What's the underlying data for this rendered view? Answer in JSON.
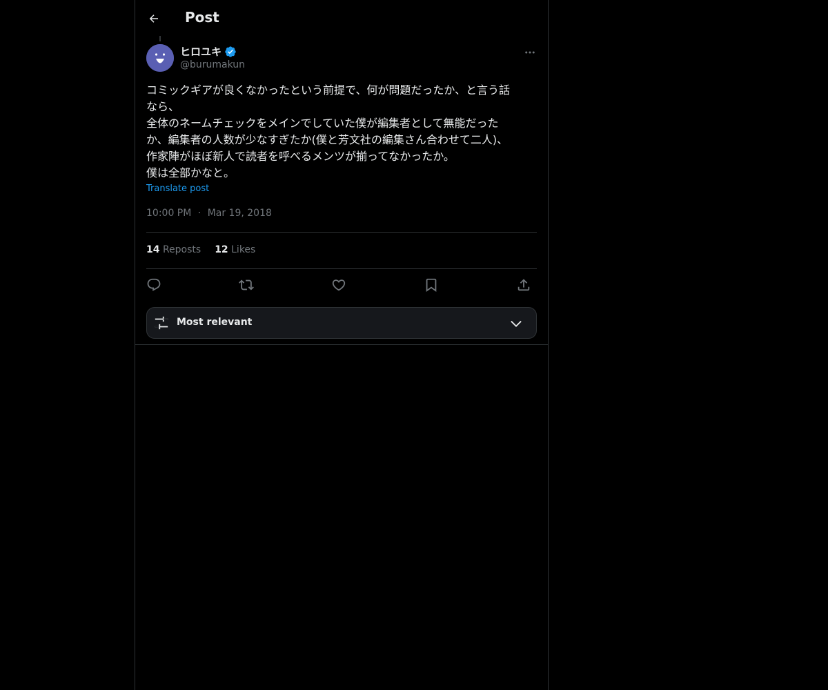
{
  "header": {
    "title": "Post",
    "back_icon": "arrow-left-icon"
  },
  "author": {
    "name": "ヒロユキ",
    "handle": "@burumakun",
    "verified": true,
    "avatar_color": "#5a5fb3"
  },
  "post": {
    "lines": [
      "コミックギアが良くなかったという前提で、何が問題だったか、と言う話",
      "なら、",
      "全体のネームチェックをメインでしていた僕が編集者として無能だった",
      "か、編集者の人数が少なすぎたか(僕と芳文社の編集さん合わせて二人)、",
      "作家陣がほぼ新人で読者を呼べるメンツが揃ってなかったか。",
      "僕は全部かなと。"
    ],
    "translate_label": "Translate post",
    "time": "10:00 PM",
    "separator": "·",
    "date": "Mar 19, 2018"
  },
  "stats": {
    "reposts_count": "14",
    "reposts_label": "Reposts",
    "likes_count": "12",
    "likes_label": "Likes"
  },
  "actions": [
    "reply-icon",
    "repost-icon",
    "like-icon",
    "bookmark-icon",
    "share-icon"
  ],
  "sort": {
    "label": "Most relevant",
    "icon": "sliders-icon",
    "chevron": "chevron-down-icon"
  },
  "colors": {
    "background": "#000000",
    "text": "#e7e9ea",
    "secondary": "#71767b",
    "accent": "#1d9bf0",
    "border": "#2f3336"
  }
}
